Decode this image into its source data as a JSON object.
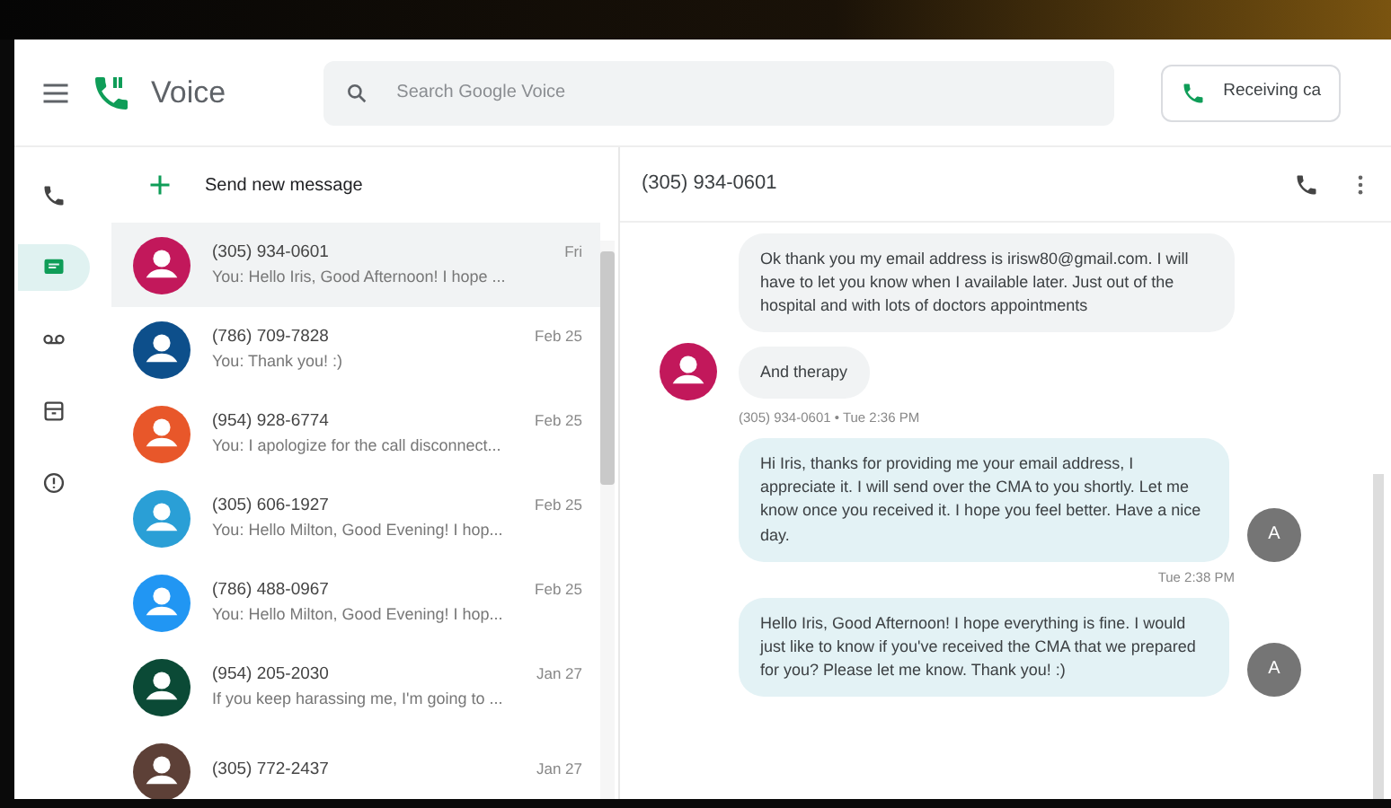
{
  "app": {
    "title": "Voice"
  },
  "search": {
    "placeholder": "Search Google Voice"
  },
  "status_button": {
    "label": "Receiving ca"
  },
  "rail": [
    {
      "kind": "phone",
      "selected": false
    },
    {
      "kind": "messages",
      "selected": true
    },
    {
      "kind": "voicemail",
      "selected": false
    },
    {
      "kind": "archive",
      "selected": false
    },
    {
      "kind": "spam",
      "selected": false
    }
  ],
  "compose": {
    "label": "Send new message"
  },
  "conversations": [
    {
      "number": "(305) 934-0601",
      "date": "Fri",
      "snippet": "You: Hello Iris, Good Afternoon! I hope ...",
      "color": "#c2185b",
      "selected": true
    },
    {
      "number": "(786) 709-7828",
      "date": "Feb 25",
      "snippet": "You: Thank you! :)",
      "color": "#0d4f8b",
      "selected": false
    },
    {
      "number": "(954) 928-6774",
      "date": "Feb 25",
      "snippet": "You: I apologize for the call disconnect...",
      "color": "#e8572a",
      "selected": false
    },
    {
      "number": "(305) 606-1927",
      "date": "Feb 25",
      "snippet": "You: Hello Milton, Good Evening! I hop...",
      "color": "#2a9fd6",
      "selected": false
    },
    {
      "number": "(786) 488-0967",
      "date": "Feb 25",
      "snippet": "You: Hello Milton, Good Evening! I hop...",
      "color": "#2196f3",
      "selected": false
    },
    {
      "number": "(954) 205-2030",
      "date": "Jan 27",
      "snippet": "If you keep harassing me, I'm going to ...",
      "color": "#0b4a36",
      "selected": false
    },
    {
      "number": "(305) 772-2437",
      "date": "Jan 27",
      "color": "#5d4037",
      "selected": false
    }
  ],
  "thread": {
    "title": "(305) 934-0601",
    "messages": [
      {
        "kind": "incoming",
        "avatar": false,
        "text": "Ok thank you my email address is irisw80@gmail.com. I will have to let you know when I available later. Just out of the hospital and with lots of doctors appointments"
      },
      {
        "kind": "incoming",
        "avatar": true,
        "text": "And therapy",
        "meta": "(305) 934-0601 • Tue 2:36 PM"
      },
      {
        "kind": "outgoing",
        "avatar": true,
        "avatar_letter": "A",
        "text": "Hi Iris, thanks for providing me your email address, I appreciate it. I will send over the CMA to you shortly. Let me know once you received it.  I hope you feel better. Have a nice day.",
        "meta": "Tue 2:38 PM"
      },
      {
        "kind": "outgoing",
        "avatar": true,
        "avatar_letter": "A",
        "text": "Hello Iris, Good Afternoon! I hope everything is fine. I would just like to know if you've received the CMA that we prepared for you? Please let me know. Thank you! :)"
      }
    ]
  }
}
